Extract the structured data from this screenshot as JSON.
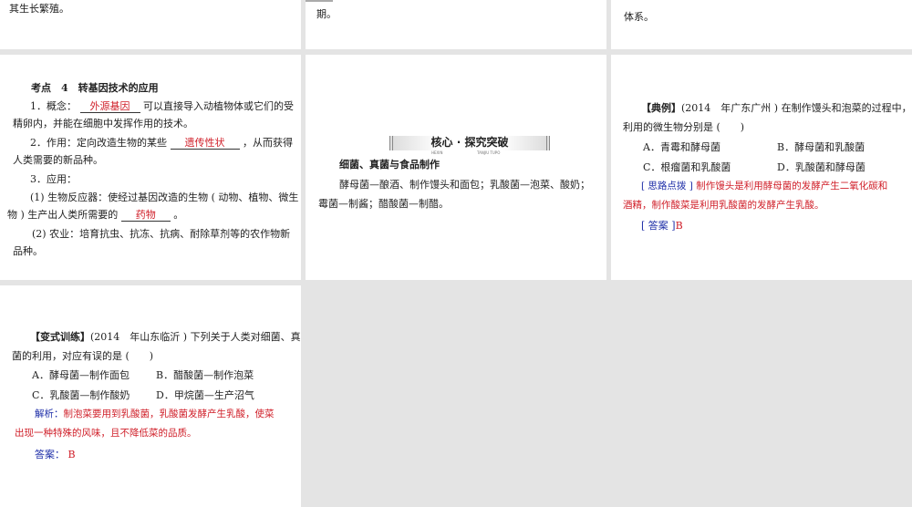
{
  "top": {
    "s1": "其生长繁殖。",
    "s2": "期。",
    "s3": "体系。"
  },
  "s4": {
    "title": "考点　4　转基因技术的应用",
    "l1a": "1．概念：",
    "b1": "外源基因",
    "l1b": "可以直接导入动植物体或它们的受",
    "l1c": "精卵内，并能在细胞中发挥作用的技术。",
    "l2a": "2．作用：定向改造生物的某些",
    "b2": "遗传性状",
    "l2b": "，从而获得",
    "l2c": "人类需要的新品种。",
    "l3": "3．应用：",
    "l4a": "(1) 生物反应器：使经过基因改造的生物 ( 动物、植物、微生",
    "l4b": "物 ) 生产出人类所需要的",
    "b3": "药物",
    "l4c": "。",
    "l5a": "(2) 农业：培育抗虫、抗冻、抗病、耐除草剂等的农作物新",
    "l5b": "品种。"
  },
  "s5": {
    "banner": "核心 · 探究突破",
    "banner_sub1": "HEXIN",
    "banner_sub2": "TANJIU TUPO",
    "heading": "细菌、真菌与食品制作",
    "l1": "酵母菌—酿酒、制作馒头和面包；乳酸菌—泡菜、酸奶；",
    "l2": "霉菌—制酱；醋酸菌—制醋。"
  },
  "s6": {
    "tag": "【典例】",
    "q1": "(2014　年广东广州 ) 在制作馒头和泡菜的过程中，",
    "q2": "利用的微生物分别是 (　　)",
    "A": "A．青霉和酵母菌",
    "B": "B．酵母菌和乳酸菌",
    "C": "C．根瘤菌和乳酸菌",
    "D": "D．乳酸菌和酵母菌",
    "hint_tag": "[ 思路点拨 ]",
    "hint1": "制作馒头是利用酵母菌的发酵产生二氧化碳和",
    "hint2": "酒精，制作酸菜是利用乳酸菌的发酵产生乳酸。",
    "ans_tag": "[ 答案 ]",
    "ans": "B"
  },
  "s7": {
    "tag": "【变式训练】",
    "q1": "(2014　年山东临沂 ) 下列关于人类对细菌、真",
    "q2": "菌的利用，对应有误的是 (　　)",
    "A": "A．酵母菌—制作面包",
    "B": "B．醋酸菌—制作泡菜",
    "C": "C．乳酸菌—制作酸奶",
    "D": "D．甲烷菌—生产沼气",
    "exp_tag": "解析：",
    "exp1": "制泡菜要用到乳酸菌，乳酸菌发酵产生乳酸，使菜",
    "exp2": "出现一种特殊的风味，且不降低菜的品质。",
    "ans_tag": "答案：",
    "ans": "B"
  }
}
